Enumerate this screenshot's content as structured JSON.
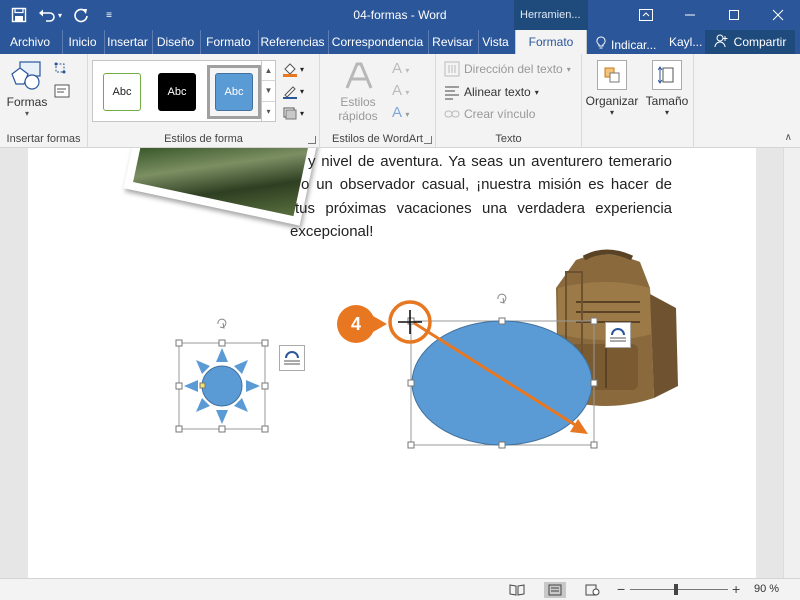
{
  "window": {
    "doc_title": "04-formas  -  Word",
    "context_tab_header": "Herramien...",
    "minimize_icon": "minimize-icon",
    "colors": {
      "titlebar": "#2b579a",
      "accent": "#2b579a",
      "highlight_orange": "#e87722",
      "shape_fill": "#5b9bd5"
    }
  },
  "quick_access": {
    "save_icon": "save-icon",
    "undo_icon": "undo-icon",
    "redo_icon": "redo-icon",
    "customize_icon": "customize-icon"
  },
  "tabs": [
    {
      "label": "Archivo"
    },
    {
      "label": "Inicio"
    },
    {
      "label": "Insertar"
    },
    {
      "label": "Diseño"
    },
    {
      "label": "Formato"
    },
    {
      "label": "Referencias"
    },
    {
      "label": "Correspondencia"
    },
    {
      "label": "Revisar"
    },
    {
      "label": "Vista"
    },
    {
      "label": "Formato",
      "active": true
    }
  ],
  "tell_me": "Indicar...",
  "user": "Kayl...",
  "share": "Compartir",
  "ribbon": {
    "insert_shapes": {
      "button_label": "Formas",
      "group_label": "Insertar formas"
    },
    "shape_styles": {
      "group_label": "Estilos de forma",
      "swatches": [
        {
          "label": "Abc",
          "fill": "#ffffff",
          "border": "#70ad47",
          "text": "#222222"
        },
        {
          "label": "Abc",
          "fill": "#000000",
          "border": "#000000",
          "text": "#ffffff"
        },
        {
          "label": "Abc",
          "fill": "#5b9bd5",
          "border": "#41719c",
          "text": "#ffffff"
        }
      ]
    },
    "wordart": {
      "quick_styles_label_1": "Estilos",
      "quick_styles_label_2": "rápidos",
      "group_label": "Estilos de WordArt"
    },
    "text": {
      "group_label": "Texto",
      "direction": "Dirección del texto",
      "align": "Alinear texto",
      "link": "Crear vínculo"
    },
    "arrange": {
      "label": "Organizar"
    },
    "size": {
      "label": "Tamaño"
    }
  },
  "document": {
    "lines": [
      "y nivel de aventura. Ya seas un aventurero temerario",
      "o un observador casual, ¡nuestra misión es hacer de",
      "tus próximas vacaciones una verdadera experiencia",
      "excepcional!"
    ],
    "step_number": "4"
  },
  "status": {
    "zoom": "90 %",
    "zoom_out": "−",
    "zoom_in": "+"
  }
}
